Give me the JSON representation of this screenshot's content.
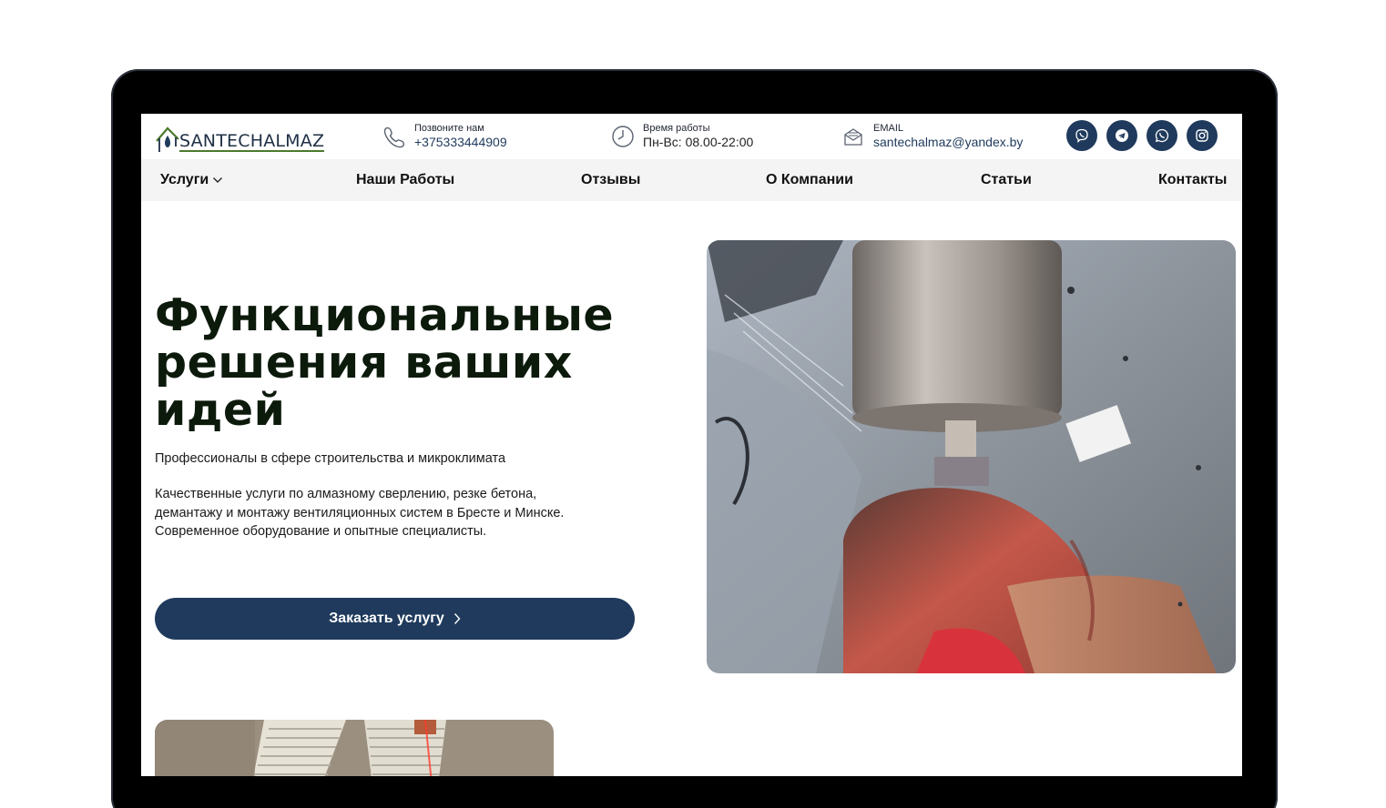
{
  "header": {
    "logo_text": "SANTECHALMAZ",
    "phone": {
      "label": "Позвоните нам",
      "value": "+375333444909"
    },
    "hours": {
      "label": "Время работы",
      "value": "Пн-Вс: 08.00-22:00"
    },
    "email": {
      "label": "EMAIL",
      "value": "santechalmaz@yandex.by"
    },
    "socials": [
      "viber-icon",
      "telegram-icon",
      "whatsapp-icon",
      "instagram-icon"
    ]
  },
  "nav": {
    "items": [
      {
        "label": "Услуги",
        "has_dropdown": true
      },
      {
        "label": "Наши Работы"
      },
      {
        "label": "Отзывы"
      },
      {
        "label": "О Компании"
      },
      {
        "label": "Статьи"
      },
      {
        "label": "Контакты"
      }
    ]
  },
  "hero": {
    "title_line1": "Функциональные",
    "title_line2": "решения ваших",
    "title_line3": "идей",
    "subtitle": "Профессионалы в сфере строительства и микроклимата",
    "desc_line1": "Качественные услуги по алмазному сверлению, резке бетона,",
    "desc_line2": "демантажу и монтажу вентиляционных систем в Бресте и Минске.",
    "desc_line3": "Современное оборудование и опытные специалисты.",
    "cta_label": "Заказать услугу"
  },
  "colors": {
    "brand": "#1f3a5c",
    "accent_green": "#4b7a2d",
    "nav_bg": "#f4f4f4",
    "title": "#0c1a0c"
  }
}
